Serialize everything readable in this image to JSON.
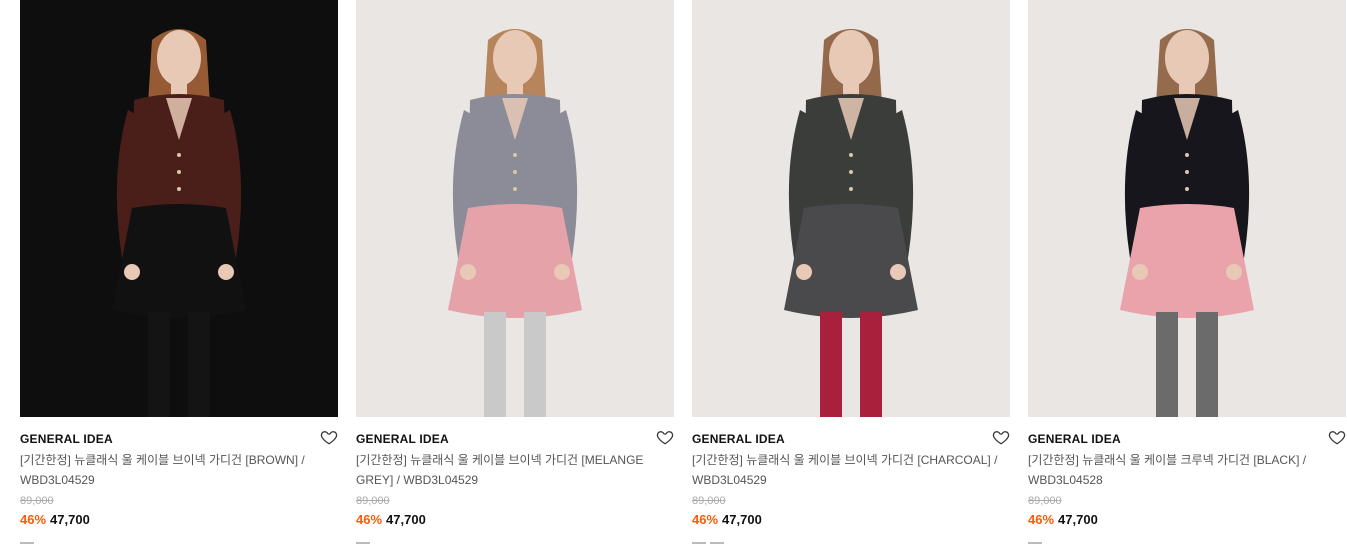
{
  "products": [
    {
      "brand": "GENERAL IDEA",
      "title": "[기간한정] 뉴클래식 울 케이블 브이넥 가디건 [BROWN] / WBD3L04529",
      "original_price": "89,000",
      "discount": "46%",
      "price": "47,700",
      "image_desc_icon": "model-photo-brown-cardigan",
      "colors": {
        "bg": "#0e0e0e",
        "top": "#4a1f1a",
        "bottom": "#111111",
        "hair": "#a5643a",
        "legs": "#141414"
      }
    },
    {
      "brand": "GENERAL IDEA",
      "title": "[기간한정] 뉴클래식 울 케이블 브이넥 가디건 [MELANGE GREY] / WBD3L04529",
      "original_price": "89,000",
      "discount": "46%",
      "price": "47,700",
      "image_desc_icon": "model-photo-grey-cardigan",
      "colors": {
        "bg": "#e9e6e3",
        "top": "#8c8c99",
        "bottom": "#e6a2a9",
        "hair": "#b07a4b",
        "legs": "#c9c9c9"
      }
    },
    {
      "brand": "GENERAL IDEA",
      "title": "[기간한정] 뉴클래식 울 케이블 브이넥 가디건 [CHARCOAL] / WBD3L04529",
      "original_price": "89,000",
      "discount": "46%",
      "price": "47,700",
      "image_desc_icon": "model-photo-charcoal-cardigan",
      "colors": {
        "bg": "#e9e6e3",
        "top": "#3b3d3b",
        "bottom": "#4a4a4c",
        "hair": "#8a5a3a",
        "legs": "#a8203c"
      }
    },
    {
      "brand": "GENERAL IDEA",
      "title": "[기간한정] 뉴클래식 울 케이블 크루넥 가디건 [BLACK] / WBD3L04528",
      "original_price": "89,000",
      "discount": "46%",
      "price": "47,700",
      "image_desc_icon": "model-photo-black-cardigan",
      "colors": {
        "bg": "#e9e6e3",
        "top": "#16161c",
        "bottom": "#eaa3ab",
        "hair": "#8b5e3c",
        "legs": "#6b6b6b"
      }
    }
  ],
  "accent_discount_color": "#ff5a00",
  "wishlist_icon": "heart-outline-icon"
}
